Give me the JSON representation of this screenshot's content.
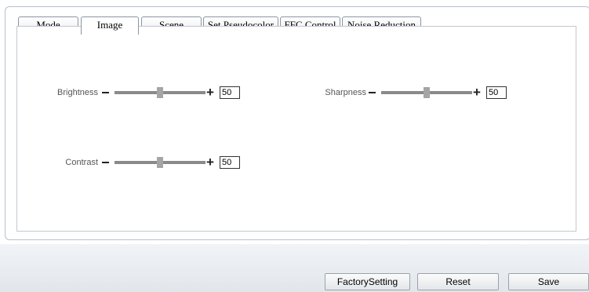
{
  "tabs": [
    "Mode",
    "Image",
    "Scene",
    "Set Pseudocolor",
    "FFC Control",
    "Noise Reduction"
  ],
  "active_tab": "Image",
  "sliders": {
    "brightness": {
      "label": "Brightness",
      "value": "50",
      "level_percent": 50
    },
    "sharpness": {
      "label": "Sharpness",
      "value": "50",
      "level_percent": 50
    },
    "contrast": {
      "label": "Contrast",
      "value": "50",
      "level_percent": 50
    }
  },
  "slider_minus": "−",
  "slider_plus": "+",
  "buttons": {
    "factory_setting": "FactorySetting",
    "reset": "Reset",
    "save": "Save"
  }
}
